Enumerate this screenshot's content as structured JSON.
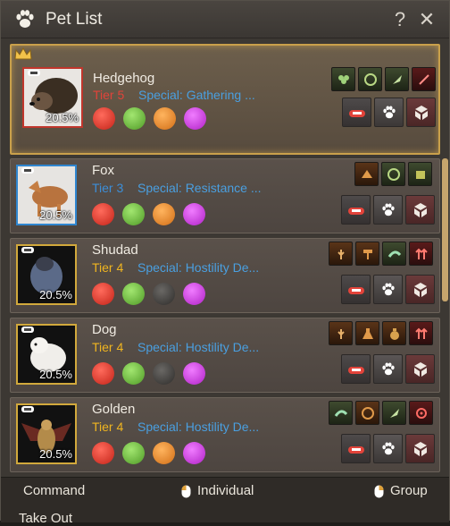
{
  "window": {
    "title": "Pet List",
    "help_label": "?",
    "close_label": "✕"
  },
  "pets": [
    {
      "name": "Hedgehog",
      "tier": "Tier 5",
      "tier_color": "#e2433a",
      "special": "Special: Gathering ...",
      "growth": "20.5%",
      "skills": [
        "clover-icon",
        "gathering-hook-icon",
        "feather-icon",
        "sword-bow-icon"
      ],
      "traits": [
        "red",
        "green",
        "orange",
        "purple"
      ]
    },
    {
      "name": "Fox",
      "tier": "Tier 3",
      "tier_color": "#3c8ed8",
      "special": "Special: Resistance ...",
      "growth": "20.5%",
      "skills": [
        "fox-running-icon",
        "gathering-hook-icon",
        "crate-icon"
      ],
      "traits": [
        "red",
        "green",
        "orange",
        "purple"
      ]
    },
    {
      "name": "Shudad",
      "tier": "Tier 4",
      "tier_color": "#f0b520",
      "special": "Special: Hostility De...",
      "growth": "20.5%",
      "skills": [
        "wheat-icon",
        "hammer-icon",
        "dolphin-icon",
        "arrows-up-icon"
      ],
      "traits": [
        "red",
        "green",
        "grey",
        "purple"
      ]
    },
    {
      "name": "Dog",
      "tier": "Tier 4",
      "tier_color": "#f0b520",
      "special": "Special: Hostility De...",
      "growth": "20.5%",
      "skills": [
        "wheat-icon",
        "flask-icon",
        "moneybag-icon",
        "arrows-up-icon"
      ],
      "traits": [
        "red",
        "green",
        "grey",
        "purple"
      ]
    },
    {
      "name": "Golden",
      "tier": "Tier 4",
      "tier_color": "#f0b520",
      "special": "Special: Hostility De...",
      "growth": "20.5%",
      "skills": [
        "dolphin-icon",
        "gathering-hook-icon",
        "feather-icon",
        "target-icon"
      ],
      "traits": [
        "red",
        "green",
        "orange",
        "purple"
      ]
    }
  ],
  "bottom": {
    "command_label": "Command",
    "individual_label": "Individual",
    "group_label": "Group",
    "takeout_label": "Take Out"
  },
  "colors": {
    "accent_gold": "#c9a04b",
    "special_blue": "#4a9fe0"
  }
}
